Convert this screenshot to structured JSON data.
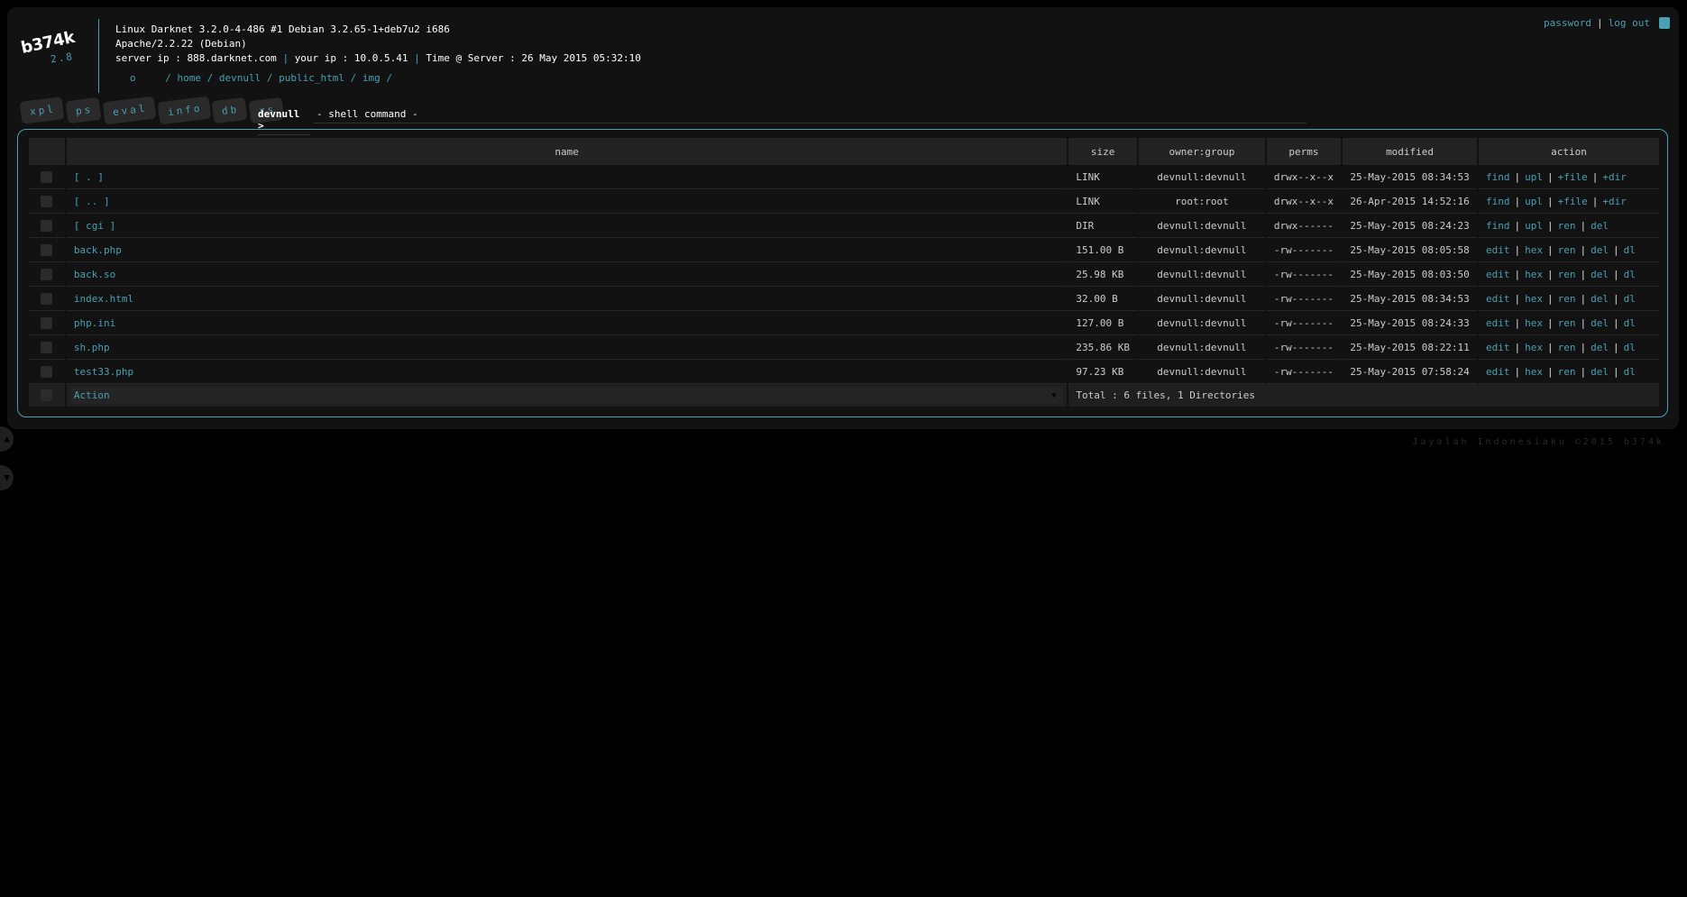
{
  "app": {
    "logo": "b374k",
    "version": "2.8"
  },
  "topbar": {
    "password_label": "password",
    "separator": "|",
    "logout_label": "log out"
  },
  "server_info": {
    "uname": "Linux Darknet 3.2.0-4-486 #1 Debian 3.2.65-1+deb7u2 i686",
    "software": "Apache/2.2.22 (Debian)",
    "server_ip_label": "server ip : 888.darknet.com",
    "your_ip_label": "your ip : 10.0.5.41",
    "time_label": "Time @ Server : 26 May 2015 05:32:10",
    "separator": "|"
  },
  "breadcrumb": {
    "root_label": "o",
    "parts": [
      {
        "sep": "/",
        "label": "home"
      },
      {
        "sep": "/",
        "label": "devnull"
      },
      {
        "sep": "/",
        "label": "public_html"
      },
      {
        "sep": "/",
        "label": "img"
      }
    ],
    "trailing": "/"
  },
  "tabs": [
    {
      "label": "xpl"
    },
    {
      "label": "ps"
    },
    {
      "label": "eval"
    },
    {
      "label": "info"
    },
    {
      "label": "db"
    },
    {
      "label": "rs"
    }
  ],
  "shell": {
    "prompt": "devnull >",
    "value": "- shell command -"
  },
  "table": {
    "headers": [
      "",
      "name",
      "size",
      "owner:group",
      "perms",
      "modified",
      "action"
    ],
    "rows": [
      {
        "name": "[ . ]",
        "size": "LINK",
        "owner": "devnull:devnull",
        "perms": "drwx--x--x",
        "modified": "25-May-2015 08:34:53",
        "actions": [
          "find",
          "upl",
          "+file",
          "+dir"
        ]
      },
      {
        "name": "[ .. ]",
        "size": "LINK",
        "owner": "root:root",
        "perms": "drwx--x--x",
        "modified": "26-Apr-2015 14:52:16",
        "actions": [
          "find",
          "upl",
          "+file",
          "+dir"
        ]
      },
      {
        "name": "[ cgi ]",
        "size": "DIR",
        "owner": "devnull:devnull",
        "perms": "drwx------",
        "modified": "25-May-2015 08:24:23",
        "actions": [
          "find",
          "upl",
          "ren",
          "del"
        ]
      },
      {
        "name": "back.php",
        "size": "151.00 B",
        "owner": "devnull:devnull",
        "perms": "-rw-------",
        "modified": "25-May-2015 08:05:58",
        "actions": [
          "edit",
          "hex",
          "ren",
          "del",
          "dl"
        ]
      },
      {
        "name": "back.so",
        "size": "25.98 KB",
        "owner": "devnull:devnull",
        "perms": "-rw-------",
        "modified": "25-May-2015 08:03:50",
        "actions": [
          "edit",
          "hex",
          "ren",
          "del",
          "dl"
        ]
      },
      {
        "name": "index.html",
        "size": "32.00 B",
        "owner": "devnull:devnull",
        "perms": "-rw-------",
        "modified": "25-May-2015 08:34:53",
        "actions": [
          "edit",
          "hex",
          "ren",
          "del",
          "dl"
        ]
      },
      {
        "name": "php.ini",
        "size": "127.00 B",
        "owner": "devnull:devnull",
        "perms": "-rw-------",
        "modified": "25-May-2015 08:24:33",
        "actions": [
          "edit",
          "hex",
          "ren",
          "del",
          "dl"
        ]
      },
      {
        "name": "sh.php",
        "size": "235.86 KB",
        "owner": "devnull:devnull",
        "perms": "-rw-------",
        "modified": "25-May-2015 08:22:11",
        "actions": [
          "edit",
          "hex",
          "ren",
          "del",
          "dl"
        ]
      },
      {
        "name": "test33.php",
        "size": "97.23 KB",
        "owner": "devnull:devnull",
        "perms": "-rw-------",
        "modified": "25-May-2015 07:58:24",
        "actions": [
          "edit",
          "hex",
          "ren",
          "del",
          "dl"
        ]
      }
    ],
    "footer": {
      "action_select": "Action",
      "total": "Total : 6 files, 1 Directories"
    }
  },
  "credit": "Jayalah Indonesiaku ©2015 b374k",
  "icons": {
    "dropdown": "triangle-down-icon",
    "scroll_up": "scroll-up-icon",
    "scroll_down": "scroll-down-icon"
  },
  "colors": {
    "accent": "#4a9fb3",
    "panel": "#121212",
    "page": "#000000"
  }
}
